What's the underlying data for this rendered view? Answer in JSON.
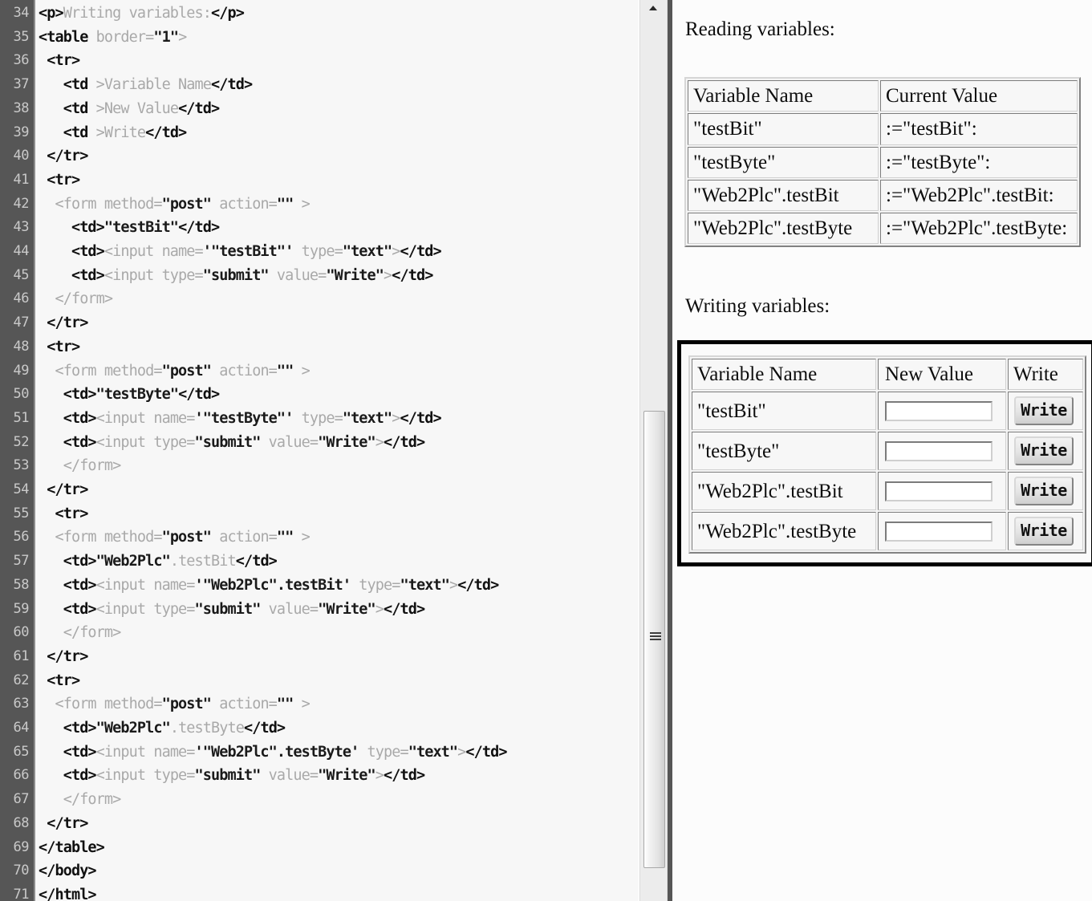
{
  "editor": {
    "first_line_number": 34,
    "lines": [
      {
        "n": 34,
        "text": "<p>Writing variables:</p>"
      },
      {
        "n": 35,
        "text": "<table border=\"1\">"
      },
      {
        "n": 36,
        "text": " <tr>"
      },
      {
        "n": 37,
        "text": "   <td >Variable Name</td>"
      },
      {
        "n": 38,
        "text": "   <td >New Value</td>"
      },
      {
        "n": 39,
        "text": "   <td >Write</td>"
      },
      {
        "n": 40,
        "text": " </tr>"
      },
      {
        "n": 41,
        "text": " <tr>"
      },
      {
        "n": 42,
        "text": "  <form method=\"post\" action=\"\" >"
      },
      {
        "n": 43,
        "text": "    <td>\"testBit\"</td>"
      },
      {
        "n": 44,
        "text": "    <td><input name='\"testBit\"' type=\"text\"></td>"
      },
      {
        "n": 45,
        "text": "    <td><input type=\"submit\" value=\"Write\"></td>"
      },
      {
        "n": 46,
        "text": "  </form>"
      },
      {
        "n": 47,
        "text": " </tr>"
      },
      {
        "n": 48,
        "text": " <tr>"
      },
      {
        "n": 49,
        "text": "  <form method=\"post\" action=\"\" >"
      },
      {
        "n": 50,
        "text": "   <td>\"testByte\"</td>"
      },
      {
        "n": 51,
        "text": "   <td><input name='\"testByte\"' type=\"text\"></td>"
      },
      {
        "n": 52,
        "text": "   <td><input type=\"submit\" value=\"Write\"></td>"
      },
      {
        "n": 53,
        "text": "   </form>"
      },
      {
        "n": 54,
        "text": " </tr>"
      },
      {
        "n": 55,
        "text": "  <tr>"
      },
      {
        "n": 56,
        "text": "  <form method=\"post\" action=\"\" >"
      },
      {
        "n": 57,
        "text": "   <td>\"Web2Plc\".testBit</td>"
      },
      {
        "n": 58,
        "text": "   <td><input name='\"Web2Plc\".testBit' type=\"text\"></td>"
      },
      {
        "n": 59,
        "text": "   <td><input type=\"submit\" value=\"Write\"></td>"
      },
      {
        "n": 60,
        "text": "   </form>"
      },
      {
        "n": 61,
        "text": " </tr>"
      },
      {
        "n": 62,
        "text": " <tr>"
      },
      {
        "n": 63,
        "text": "  <form method=\"post\" action=\"\" >"
      },
      {
        "n": 64,
        "text": "   <td>\"Web2Plc\".testByte</td>"
      },
      {
        "n": 65,
        "text": "   <td><input name='\"Web2Plc\".testByte' type=\"text\"></td>"
      },
      {
        "n": 66,
        "text": "   <td><input type=\"submit\" value=\"Write\"></td>"
      },
      {
        "n": 67,
        "text": "   </form>"
      },
      {
        "n": 68,
        "text": " </tr>"
      },
      {
        "n": 69,
        "text": "</table>"
      },
      {
        "n": 70,
        "text": "</body>"
      },
      {
        "n": 71,
        "text": "</html>"
      }
    ]
  },
  "scrollbar": {
    "up_arrow_icon": "triangle-up-icon",
    "grip_icon": "grip-lines-icon"
  },
  "preview": {
    "reading_label": "Reading variables:",
    "writing_label": "Writing variables:",
    "reading_table": {
      "headers": [
        "Variable Name",
        "Current Value"
      ],
      "rows": [
        [
          "\"testBit\"",
          ":=\"testBit\":"
        ],
        [
          "\"testByte\"",
          ":=\"testByte\":"
        ],
        [
          "\"Web2Plc\".testBit",
          ":=\"Web2Plc\".testBit:"
        ],
        [
          "\"Web2Plc\".testByte",
          ":=\"Web2Plc\".testByte:"
        ]
      ]
    },
    "writing_table": {
      "headers": [
        "Variable Name",
        "New Value",
        "Write"
      ],
      "rows": [
        {
          "name": "\"testBit\"",
          "value": "",
          "placeholder": "",
          "button": "Write"
        },
        {
          "name": "\"testByte\"",
          "value": "",
          "placeholder": "",
          "button": "Write"
        },
        {
          "name": "\"Web2Plc\".testBit",
          "value": "",
          "placeholder": "",
          "button": "Write"
        },
        {
          "name": "\"Web2Plc\".testByte",
          "value": "",
          "placeholder": "",
          "button": "Write"
        }
      ]
    }
  },
  "colors": {
    "gutter_bg": "#565656",
    "gutter_text": "#c9c9c9",
    "code_bg": "#f7f7f7",
    "code_dim": "#a9a9a9",
    "code_bold": "#111111",
    "highlight_border": "#000000"
  }
}
